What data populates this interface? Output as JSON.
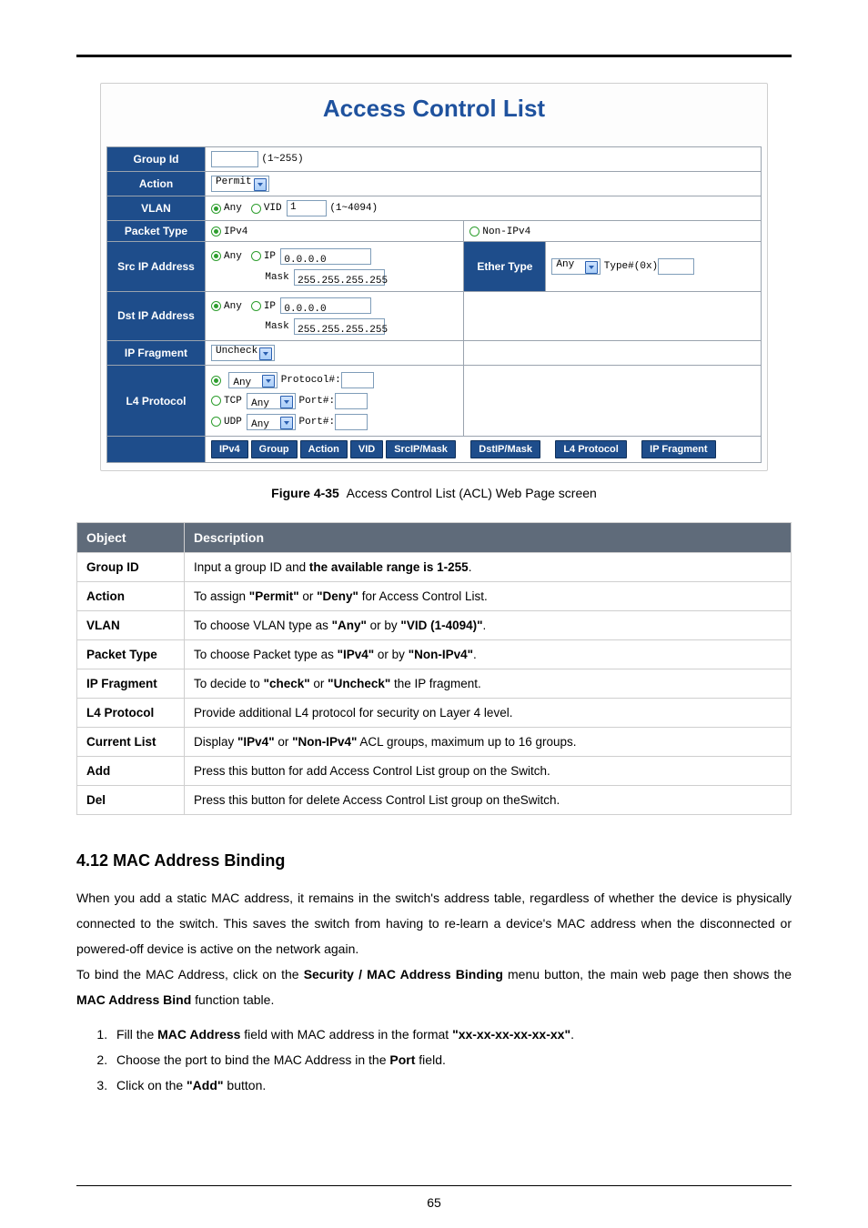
{
  "acl": {
    "title": "Access Control List",
    "rows": {
      "group_id": {
        "label": "Group Id",
        "hint": "(1~255)",
        "value": ""
      },
      "action": {
        "label": "Action",
        "value": "Permit"
      },
      "vlan": {
        "label": "VLAN",
        "any": "Any",
        "vid": "VID",
        "value": "1",
        "hint": "(1~4094)"
      },
      "packet": {
        "label": "Packet Type",
        "ipv4": "IPv4",
        "non_ipv4": "Non-IPv4"
      },
      "src_ip": {
        "label": "Src IP Address",
        "any": "Any",
        "ip": "IP",
        "ip_val": "0.0.0.0",
        "mask": "Mask",
        "mask_val": "255.255.255.255"
      },
      "ether": {
        "label": "Ether Type",
        "sel": "Any",
        "typehex": "Type#(0x)",
        "hex_val": ""
      },
      "dst_ip": {
        "label": "Dst IP Address",
        "any": "Any",
        "ip": "IP",
        "ip_val": "0.0.0.0",
        "mask": "Mask",
        "mask_val": "255.255.255.255"
      },
      "ipfrag": {
        "label": "IP Fragment",
        "value": "Uncheck"
      },
      "l4": {
        "label": "L4 Protocol",
        "any": "Any",
        "proto": "Protocol#:",
        "tcp": "TCP",
        "udp": "UDP",
        "port": "Port#:",
        "sel_any": "Any"
      }
    },
    "columns": [
      "IPv4",
      "Group",
      "Action",
      "VID",
      "SrcIP/Mask",
      "DstIP/Mask",
      "L4 Protocol",
      "IP Fragment"
    ]
  },
  "caption": {
    "prefix": "Figure 4-35",
    "text": "Access Control List (ACL) Web Page screen"
  },
  "desc": {
    "head": [
      "Object",
      "Description"
    ],
    "rows": [
      {
        "obj": "Group ID",
        "d": [
          "Input a group ID and ",
          "the available range is 1-255",
          "."
        ]
      },
      {
        "obj": "Action",
        "d": [
          "To assign ",
          "\"Permit\"",
          " or ",
          "\"Deny\"",
          " for Access Control List."
        ]
      },
      {
        "obj": "VLAN",
        "d": [
          "To choose VLAN type as ",
          "\"Any\"",
          " or by ",
          "\"VID (1-4094)\"",
          "."
        ]
      },
      {
        "obj": "Packet Type",
        "d": [
          "To choose Packet type as ",
          "\"IPv4\"",
          " or by ",
          "\"Non-IPv4\"",
          "."
        ]
      },
      {
        "obj": "IP Fragment",
        "d": [
          "To decide to ",
          "\"check\"",
          " or ",
          "\"Uncheck\"",
          " the IP fragment."
        ]
      },
      {
        "obj": "L4 Protocol",
        "d": [
          "Provide additional L4 protocol for security on Layer 4 level."
        ]
      },
      {
        "obj": "Current List",
        "d": [
          "Display ",
          "\"IPv4\"",
          " or ",
          "\"Non-IPv4\"",
          " ACL groups, maximum up to 16 groups."
        ]
      },
      {
        "obj": "Add",
        "d": [
          "Press this button for add Access Control List group on the Switch."
        ]
      },
      {
        "obj": "Del",
        "d": [
          "Press this button for delete Access Control List group on theSwitch."
        ]
      }
    ]
  },
  "section": {
    "num": "4.12",
    "title": "MAC Address Binding",
    "para": "When you add a static MAC address, it remains in the switch's address table, regardless of whether the device is physically connected to the switch. This saves the switch from having to re-learn a device's MAC address when the disconnected or powered-off device is active on the network again.",
    "lead": {
      "a": "To bind the MAC Address, click on the ",
      "b": "Security / MAC Address Binding",
      "c": " menu button, the main web page then shows the ",
      "d": "MAC Address Bind",
      "e": " function table."
    },
    "steps": [
      {
        "a": "Fill the ",
        "b": "MAC Address",
        "c": " field with MAC address in the format ",
        "d": "\"xx-xx-xx-xx-xx-xx\"",
        "e": "."
      },
      {
        "a": "Choose the port to bind the MAC Address in the ",
        "b": "Port",
        "c": " field."
      },
      {
        "a": "Click on the ",
        "b": "\"Add\"",
        "c": " button."
      }
    ]
  },
  "page_number": "65"
}
